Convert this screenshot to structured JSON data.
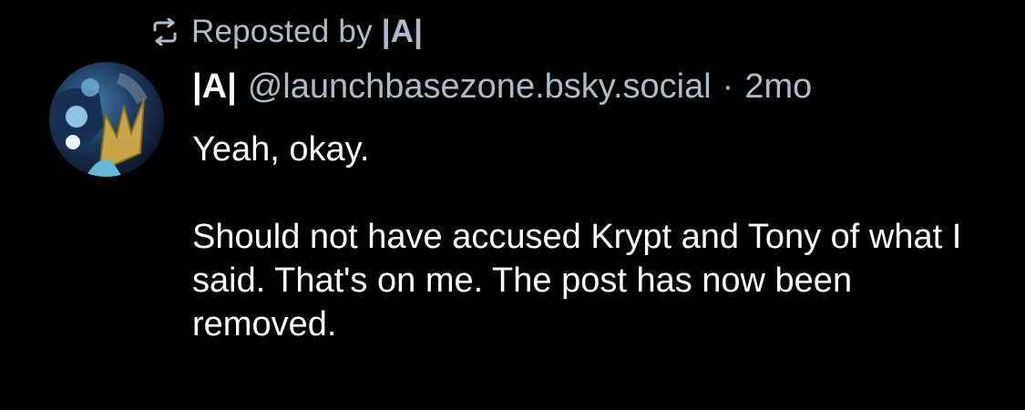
{
  "repost": {
    "label": "Reposted by",
    "by": "|A|",
    "icon": "repost-icon"
  },
  "post": {
    "author_display_name": "|A|",
    "handle": "@launchbasezone.bsky.social",
    "separator": "·",
    "time": "2mo",
    "paragraphs": [
      "Yeah, okay.",
      "Should not have accused Krypt and Tony of what I said. That's on me. The post has now been removed."
    ]
  },
  "colors": {
    "background": "#000000",
    "text_primary": "#ffffff",
    "text_secondary": "#aebbc9"
  }
}
